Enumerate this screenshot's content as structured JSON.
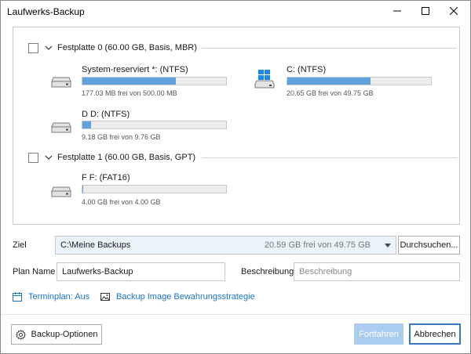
{
  "window": {
    "title": "Laufwerks-Backup"
  },
  "disks": [
    {
      "title": "Festplatte 0 (60.00 GB, Basis, MBR)",
      "partitions": [
        {
          "name": "System-reserviert *: (NTFS)",
          "free_text": "177.03 MB frei von 500.00 MB",
          "used_fraction": 0.65,
          "icon": "drive-icon"
        },
        {
          "name": "C: (NTFS)",
          "free_text": "20.65 GB frei von 49.75 GB",
          "used_fraction": 0.58,
          "icon": "windows-drive-icon"
        },
        {
          "name": "D D: (NTFS)",
          "free_text": "9.18 GB frei von 9.76 GB",
          "used_fraction": 0.06,
          "icon": "drive-icon"
        }
      ]
    },
    {
      "title": "Festplatte 1 (60.00 GB, Basis, GPT)",
      "partitions": [
        {
          "name": "F F: (FAT16)",
          "free_text": "4.00 GB frei von 4.00 GB",
          "used_fraction": 0.005,
          "icon": "drive-icon"
        }
      ]
    }
  ],
  "target": {
    "label": "Ziel",
    "path": "C:\\Meine Backups",
    "free_text": "20.59 GB frei von 49.75 GB",
    "browse_label": "Durchsuchen..."
  },
  "plan": {
    "name_label": "Plan Name",
    "name_value": "Laufwerks-Backup",
    "desc_label": "Beschreibung",
    "desc_placeholder": "Beschreibung"
  },
  "links": {
    "schedule": "Terminplan: Aus",
    "retention": "Backup Image Bewahrungsstrategie"
  },
  "footer": {
    "options_label": "Backup-Optionen",
    "continue_label": "Fortfahren",
    "cancel_label": "Abbrechen"
  },
  "colors": {
    "accent": "#1a73c8",
    "bar_fill": "#5ea2e0",
    "disabled_button": "#a9ccef"
  }
}
